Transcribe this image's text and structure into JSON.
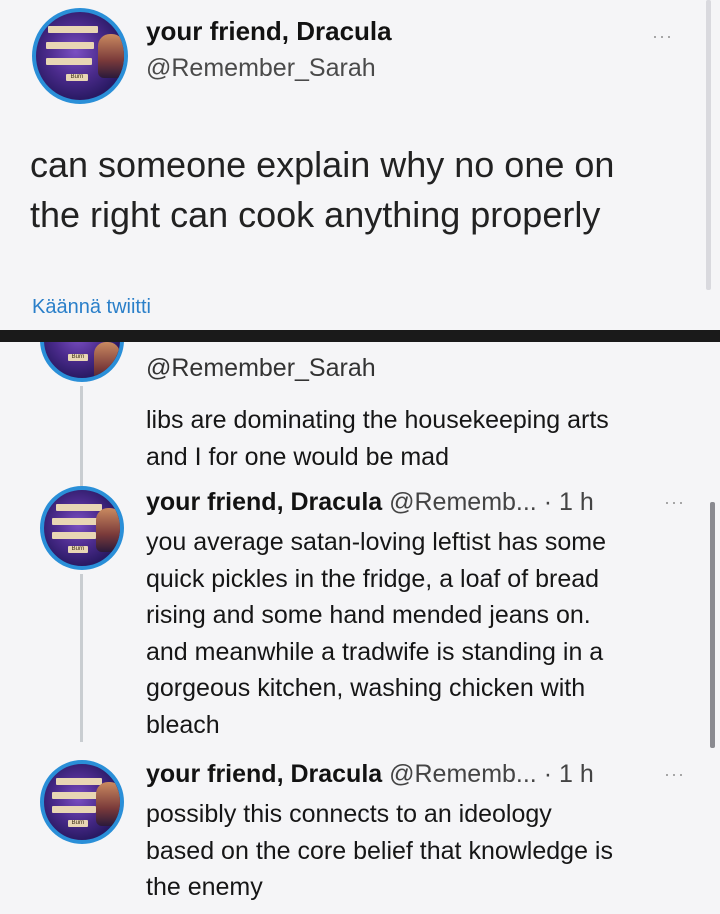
{
  "top_tweet": {
    "display_name": "your friend, Dracula",
    "handle": "@Remember_Sarah",
    "more_label": "···",
    "text_line1": "can someone explain why no one on",
    "text_line2": "the right can cook anything properly",
    "translate_label": "Käännä twiitti"
  },
  "avatar_text": [
    "ok",
    "ay",
    "",
    "Burn"
  ],
  "replies": [
    {
      "handle": "@Remember_Sarah",
      "lines": [
        "libs are dominating the housekeeping arts",
        "and I for one would be mad"
      ]
    },
    {
      "display_name": "your friend, Dracula",
      "handle_time": "@Rememb... · 1 h",
      "more_label": "···",
      "lines": [
        "you average satan-loving leftist has some",
        "quick pickles in the fridge, a loaf of bread",
        "rising and some hand mended jeans on.",
        "and meanwhile a tradwife is standing in a",
        "gorgeous kitchen, washing chicken with",
        "bleach"
      ]
    },
    {
      "display_name": "your friend, Dracula",
      "handle_time": "@Rememb... · 1 h",
      "more_label": "···",
      "lines": [
        "possibly this connects to an ideology",
        "based on the core belief that knowledge is",
        "the enemy"
      ]
    }
  ],
  "colors": {
    "link": "#2a7fc9",
    "avatar_ring": "#2a8fd8",
    "divider": "#1a1a1a"
  }
}
